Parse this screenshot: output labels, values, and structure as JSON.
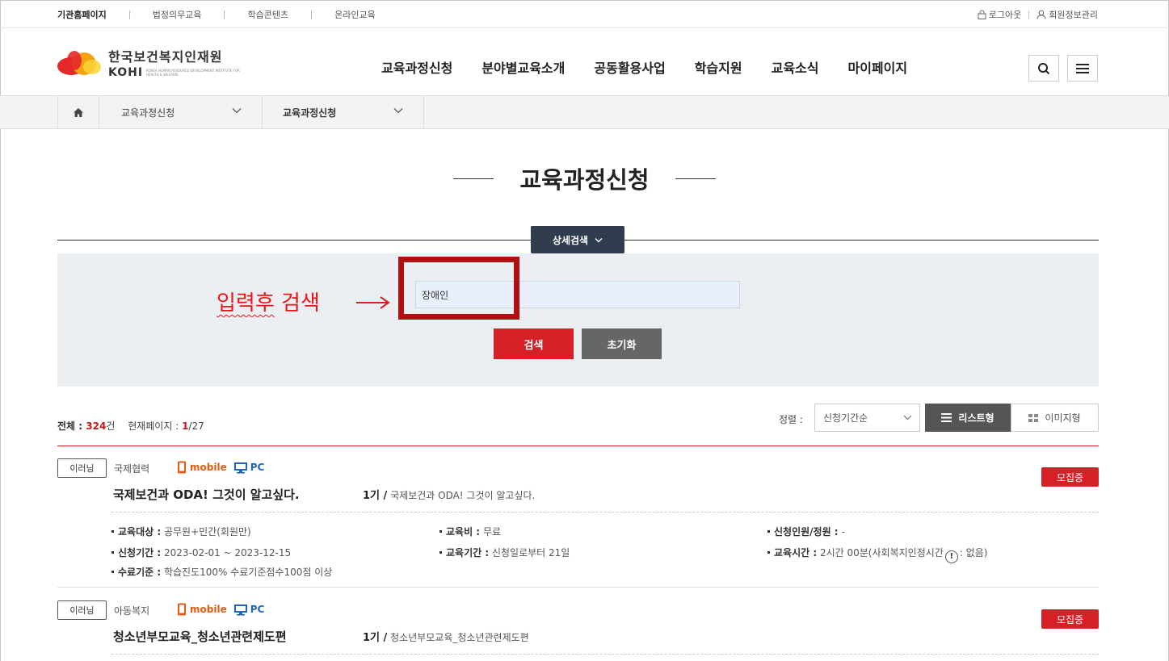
{
  "util": {
    "links": [
      "기관홈페이지",
      "법정의무교육",
      "학습콘텐츠",
      "온라인교육"
    ],
    "logout": "로그아웃",
    "member": "회원정보관리"
  },
  "logo": {
    "kr": "한국보건복지인재원",
    "en": "KOHI",
    "sub": "KOREA HUMAN RESOURCE DEVELOPMENT INSTITUTE FOR HEALTH & WELFARE"
  },
  "gnb": [
    "교육과정신청",
    "분야별교육소개",
    "공동활용사업",
    "학습지원",
    "교육소식",
    "마이페이지"
  ],
  "breadcrumb": {
    "level1": "교육과정신청",
    "level2": "교육과정신청"
  },
  "page_title": "교육과정신청",
  "search": {
    "detail_label": "상세검색",
    "input_value": "장애인",
    "annotation_text": "입력후",
    "annotation_text2": " 검색",
    "search_button": "검색",
    "reset_button": "초기화"
  },
  "list": {
    "total_label": "전체 : ",
    "total": "324",
    "total_unit": "건",
    "page_label": "현재페이지 : ",
    "page_current": "1",
    "page_total": "/27",
    "sort_label": "정렬 :",
    "sort_value": "신청기간순",
    "view_list": "리스트형",
    "view_image": "이미지형"
  },
  "courses": [
    {
      "type": "이러닝",
      "category": "국제협력",
      "mobile": "mobile",
      "pc": "PC",
      "title": "국제보건과 ODA! 그것이 알고싶다.",
      "term": "1기 /",
      "subtitle": "국제보건과 ODA! 그것이 알고싶다.",
      "status": "모집중",
      "target_label": "교육대상 :",
      "target": "공무원+민간(회원만)",
      "fee_label": "교육비 :",
      "fee": "무료",
      "capacity_label": "신청인원/정원 :",
      "capacity": "-",
      "apply_label": "신청기간 :",
      "apply": "2023-02-01 ~ 2023-12-15",
      "period_label": "교육기간 :",
      "period": "신청일로부터 21일",
      "hours_label": "교육시간 :",
      "hours": "2시간 00분(사회복지인정시간",
      "hours_tail": ": 없음)",
      "complete_label": "수료기준 :",
      "complete": "학습진도100% 수료기준점수100점 이상"
    },
    {
      "type": "이러닝",
      "category": "아동복지",
      "mobile": "mobile",
      "pc": "PC",
      "title": "청소년부모교육_청소년관련제도편",
      "term": "1기 /",
      "subtitle": "청소년부모교육_청소년관련제도편",
      "status": "모집중"
    }
  ],
  "colors": {
    "accent_red": "#d71f26",
    "navy": "#2f3d4f"
  }
}
